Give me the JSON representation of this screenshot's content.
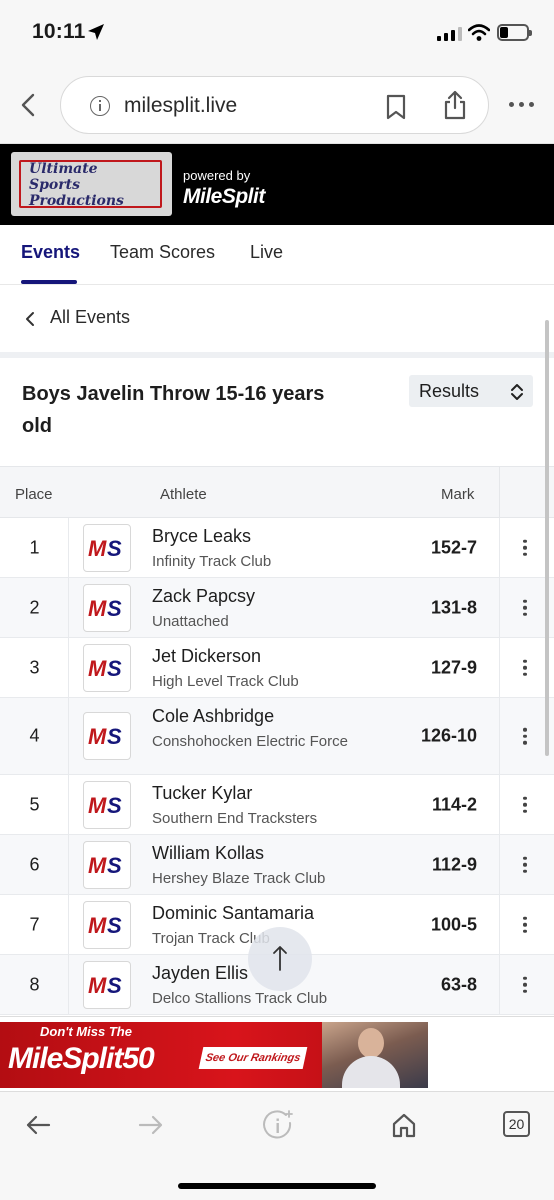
{
  "status_bar": {
    "time": "10:11"
  },
  "browser": {
    "url": "milesplit.live",
    "tab_count": "20"
  },
  "site_header": {
    "logo_lines": [
      "Ultimate",
      "Sports",
      "Productions"
    ],
    "powered_by": "powered by",
    "brand": "MileSplit"
  },
  "tabs": [
    {
      "label": "Events",
      "active": true
    },
    {
      "label": "Team Scores",
      "active": false
    },
    {
      "label": "Live",
      "active": false
    }
  ],
  "nav": {
    "back_label": "All Events"
  },
  "event": {
    "title": "Boys Javelin Throw 15-16 years old",
    "view_select": "Results"
  },
  "table": {
    "headers": {
      "place": "Place",
      "athlete": "Athlete",
      "mark": "Mark"
    },
    "rows": [
      {
        "place": "1",
        "name": "Bryce Leaks",
        "team": "Infinity Track Club",
        "mark": "152-7"
      },
      {
        "place": "2",
        "name": "Zack Papcsy",
        "team": "Unattached",
        "mark": "131-8"
      },
      {
        "place": "3",
        "name": "Jet Dickerson",
        "team": "High Level Track Club",
        "mark": "127-9"
      },
      {
        "place": "4",
        "name": "Cole Ashbridge",
        "team": "Conshohocken Electric Force",
        "mark": "126-10"
      },
      {
        "place": "5",
        "name": "Tucker Kylar",
        "team": "Southern End Tracksters",
        "mark": "114-2"
      },
      {
        "place": "6",
        "name": "William Kollas",
        "team": "Hershey Blaze Track Club",
        "mark": "112-9"
      },
      {
        "place": "7",
        "name": "Dominic Santamaria",
        "team": "Trojan Track Club",
        "mark": "100-5"
      },
      {
        "place": "8",
        "name": "Jayden Ellis",
        "team": "Delco Stallions Track Club",
        "mark": "63-8"
      }
    ]
  },
  "ad": {
    "line1": "Don't Miss The",
    "line2": "MileSplit50",
    "cta": "See Our Rankings"
  },
  "colors": {
    "accent": "#15167a",
    "brand_red": "#c0181c",
    "header_bg": "#000000"
  },
  "icons": [
    "location-arrow-icon",
    "signal-icon",
    "wifi-icon",
    "battery-icon",
    "back-chevron-icon",
    "info-icon",
    "bookmark-icon",
    "share-icon",
    "more-icon",
    "chevron-left-icon",
    "up-down-chevron-icon",
    "kebab-icon",
    "arrow-up-icon",
    "back-arrow-icon",
    "forward-arrow-icon",
    "info-sparkle-icon",
    "home-icon",
    "tabs-icon"
  ]
}
